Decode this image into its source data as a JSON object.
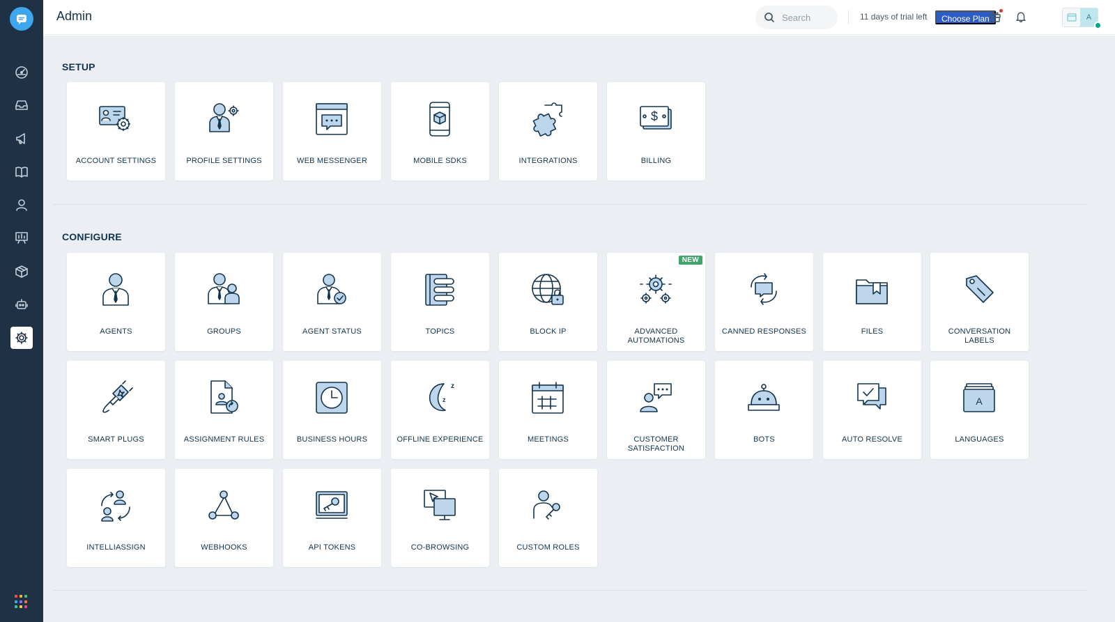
{
  "header": {
    "title": "Admin",
    "search_placeholder": "Search",
    "trial_text": "11 days of trial left",
    "choose_plan_label": "Choose Plan",
    "avatar_letter": "A"
  },
  "sidebar": {
    "items": [
      {
        "name": "dashboard-icon"
      },
      {
        "name": "inbox-icon"
      },
      {
        "name": "campaigns-icon"
      },
      {
        "name": "knowledge-base-icon"
      },
      {
        "name": "contacts-icon"
      },
      {
        "name": "analytics-icon"
      },
      {
        "name": "marketplace-icon"
      },
      {
        "name": "bots-icon"
      },
      {
        "name": "settings-icon",
        "active": true
      }
    ],
    "apps_grid_colors": [
      "#f94d4d",
      "#ffb020",
      "#4cbf7c",
      "#3ea6ec",
      "#8f6bf3",
      "#ff7043",
      "#2fc6b4",
      "#ffcc33",
      "#e6467f"
    ]
  },
  "sections": {
    "setup": {
      "title": "SETUP",
      "cards": [
        {
          "label": "ACCOUNT SETTINGS",
          "icon": "account-settings-icon"
        },
        {
          "label": "PROFILE SETTINGS",
          "icon": "profile-settings-icon"
        },
        {
          "label": "WEB MESSENGER",
          "icon": "web-messenger-icon"
        },
        {
          "label": "MOBILE SDKS",
          "icon": "mobile-sdks-icon"
        },
        {
          "label": "INTEGRATIONS",
          "icon": "integrations-icon"
        },
        {
          "label": "BILLING",
          "icon": "billing-icon"
        }
      ]
    },
    "configure": {
      "title": "CONFIGURE",
      "cards": [
        {
          "label": "AGENTS",
          "icon": "agents-icon"
        },
        {
          "label": "GROUPS",
          "icon": "groups-icon"
        },
        {
          "label": "AGENT STATUS",
          "icon": "agent-status-icon"
        },
        {
          "label": "TOPICS",
          "icon": "topics-icon"
        },
        {
          "label": "BLOCK IP",
          "icon": "block-ip-icon"
        },
        {
          "label": "ADVANCED AUTOMATIONS",
          "icon": "advanced-automations-icon",
          "badge": "NEW"
        },
        {
          "label": "CANNED RESPONSES",
          "icon": "canned-responses-icon"
        },
        {
          "label": "FILES",
          "icon": "files-icon"
        },
        {
          "label": "CONVERSATION LABELS",
          "icon": "conversation-labels-icon"
        },
        {
          "label": "SMART PLUGS",
          "icon": "smart-plugs-icon"
        },
        {
          "label": "ASSIGNMENT RULES",
          "icon": "assignment-rules-icon"
        },
        {
          "label": "BUSINESS HOURS",
          "icon": "business-hours-icon"
        },
        {
          "label": "OFFLINE EXPERIENCE",
          "icon": "offline-experience-icon"
        },
        {
          "label": "MEETINGS",
          "icon": "meetings-icon"
        },
        {
          "label": "CUSTOMER SATISFACTION",
          "icon": "customer-satisfaction-icon"
        },
        {
          "label": "BOTS",
          "icon": "bots-icon"
        },
        {
          "label": "AUTO RESOLVE",
          "icon": "auto-resolve-icon"
        },
        {
          "label": "LANGUAGES",
          "icon": "languages-icon"
        },
        {
          "label": "INTELLIASSIGN",
          "icon": "intelliassign-icon"
        },
        {
          "label": "WEBHOOKS",
          "icon": "webhooks-icon"
        },
        {
          "label": "API TOKENS",
          "icon": "api-tokens-icon"
        },
        {
          "label": "CO-BROWSING",
          "icon": "co-browsing-icon"
        },
        {
          "label": "CUSTOM ROLES",
          "icon": "custom-roles-icon"
        }
      ]
    }
  },
  "colors": {
    "sidebar_bg": "#1f3145",
    "main_bg": "#ebeff3",
    "icon_fill": "#bed6ec",
    "icon_stroke": "#12344d",
    "primary_button": "#2c5cc5",
    "new_badge": "#41a46b"
  }
}
